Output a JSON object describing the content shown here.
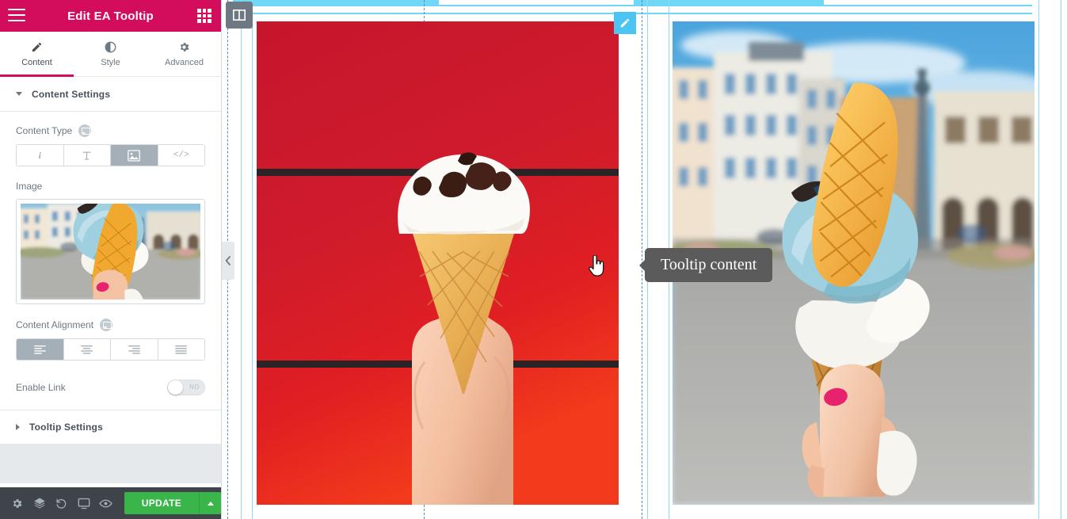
{
  "panel": {
    "title": "Edit EA Tooltip",
    "menu_icon": "hamburger-menu-icon",
    "apps_icon": "apps-grid-icon",
    "tabs": [
      {
        "label": "Content",
        "icon": "pencil-icon",
        "active": true
      },
      {
        "label": "Style",
        "icon": "contrast-icon",
        "active": false
      },
      {
        "label": "Advanced",
        "icon": "gear-icon",
        "active": false
      }
    ],
    "sections": [
      {
        "title": "Content Settings",
        "expanded": true
      },
      {
        "title": "Tooltip Settings",
        "expanded": false
      }
    ],
    "content_type": {
      "label": "Content Type",
      "options": [
        {
          "name": "info",
          "glyph": "i",
          "selected": false
        },
        {
          "name": "text",
          "glyph": "T",
          "selected": false
        },
        {
          "name": "image",
          "glyph": "img",
          "selected": true
        },
        {
          "name": "code",
          "glyph": "</>",
          "selected": false
        }
      ]
    },
    "image": {
      "label": "Image",
      "alt": "ice cream cone in a city square"
    },
    "content_alignment": {
      "label": "Content Alignment",
      "options": [
        {
          "name": "align-left",
          "selected": true
        },
        {
          "name": "align-center",
          "selected": false
        },
        {
          "name": "align-right",
          "selected": false
        },
        {
          "name": "align-justify",
          "selected": false
        }
      ]
    },
    "enable_link": {
      "label": "Enable Link",
      "state": "NO",
      "on": false
    },
    "collapse_handle_icon": "chevron-left-icon"
  },
  "footer": {
    "icons": [
      {
        "name": "settings-gear-icon"
      },
      {
        "name": "navigator-layers-icon"
      },
      {
        "name": "history-revisions-icon"
      },
      {
        "name": "responsive-mode-icon"
      },
      {
        "name": "preview-eye-icon"
      }
    ],
    "update_label": "UPDATE",
    "update_caret_icon": "caret-up-icon",
    "update_color": "#39b54a"
  },
  "canvas": {
    "section_handle_icon": "columns-handle-icon",
    "widget_edit_icon": "pencil-edit-icon",
    "tooltip_text": "Tooltip content",
    "tooltip_bg": "#5b5b5b",
    "cursor": "pointer-hand-cursor",
    "left_image_alt": "hand holding cookies-and-cream ice cream cone on red background",
    "right_image_alt": "hand holding blue ice cream cone with wafer in a city square"
  },
  "colors": {
    "header_pink": "#d30c5c",
    "footer_dark": "#3f444b",
    "outline_blue": "#71d7f7",
    "edit_blue": "#4cc5f2",
    "selected_gray": "#a4afb7"
  }
}
